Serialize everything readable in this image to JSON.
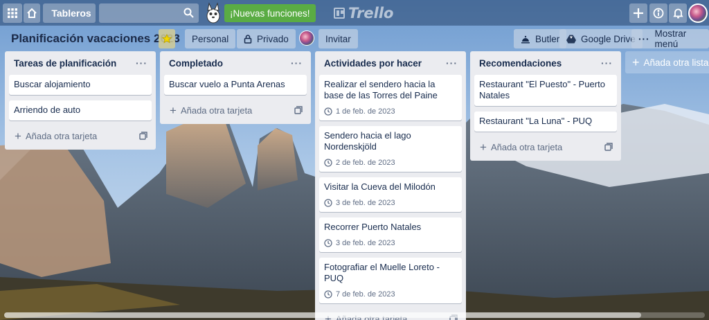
{
  "header": {
    "boards_label": "Tableros",
    "search_placeholder": "",
    "news_label": "¡Nuevas funciones!",
    "logo_text": "Trello"
  },
  "board": {
    "title": "Planificación vacaciones 2023",
    "workspace_label": "Personal",
    "visibility_label": "Privado",
    "invite_label": "Invitar",
    "butler_label": "Butler",
    "drive_label": "Google Drive",
    "menu_label": "Mostrar menú"
  },
  "lists": [
    {
      "title": "Tareas de planificación",
      "cards": [
        {
          "title": "Buscar alojamiento"
        },
        {
          "title": "Arriendo de auto"
        }
      ],
      "add_card_label": "Añada otra tarjeta"
    },
    {
      "title": "Completado",
      "cards": [
        {
          "title": "Buscar vuelo a Punta Arenas"
        }
      ],
      "add_card_label": "Añada otra tarjeta"
    },
    {
      "title": "Actividades por hacer",
      "cards": [
        {
          "title": "Realizar el sendero hacia la base de las Torres del Paine",
          "date": "1 de feb. de 2023"
        },
        {
          "title": "Sendero hacia el lago Nordenskjöld",
          "date": "2 de feb. de 2023"
        },
        {
          "title": "Visitar la Cueva del Milodón",
          "date": "3 de feb. de 2023"
        },
        {
          "title": "Recorrer Puerto Natales",
          "date": "3 de feb. de 2023"
        },
        {
          "title": "Fotografiar el Muelle Loreto - PUQ",
          "date": "7 de feb. de 2023"
        }
      ],
      "add_card_label": "Añada otra tarjeta"
    },
    {
      "title": "Recomendaciones",
      "cards": [
        {
          "title": "Restaurant \"El Puesto\" - Puerto Natales"
        },
        {
          "title": "Restaurant \"La Luna\" - PUQ"
        }
      ],
      "add_card_label": "Añada otra tarjeta"
    }
  ],
  "add_list_label": "Añada otra lista",
  "list_menu_glyph": "···",
  "colors": {
    "news_green": "#5aac44",
    "list_bg": "#ebecf0",
    "star_yellow": "#f2d600"
  }
}
